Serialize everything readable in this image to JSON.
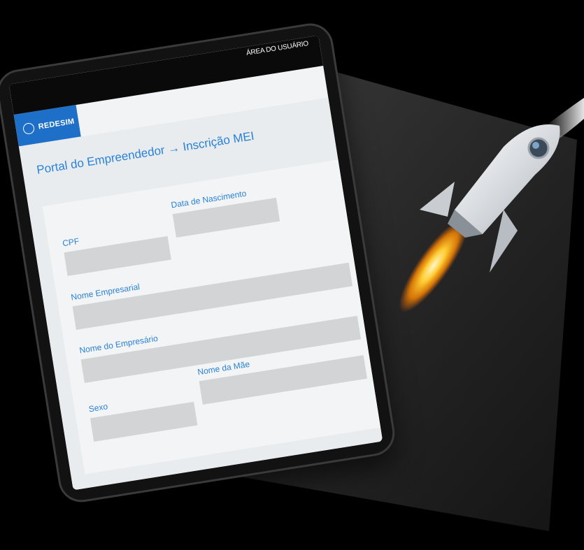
{
  "header": {
    "user_area": "ÁREA DO USUÁRIO"
  },
  "brand": {
    "name": "REDESIM"
  },
  "page": {
    "title": "Portal do Empreendedor → Inscrição MEI"
  },
  "form": {
    "fields": [
      {
        "label": "CPF",
        "value": ""
      },
      {
        "label": "Data de Nascimento",
        "value": ""
      },
      {
        "label": "Nome Empresarial",
        "value": ""
      },
      {
        "label": "Nome do Empresário",
        "value": ""
      },
      {
        "label": "Sexo",
        "value": ""
      },
      {
        "label": "Nome da Mãe",
        "value": ""
      }
    ]
  },
  "colors": {
    "brand": "#1e6fc8",
    "label": "#2a82d8",
    "field": "#d3d4d5"
  },
  "icons": [
    "redesim-logo-icon",
    "rocket-icon"
  ]
}
